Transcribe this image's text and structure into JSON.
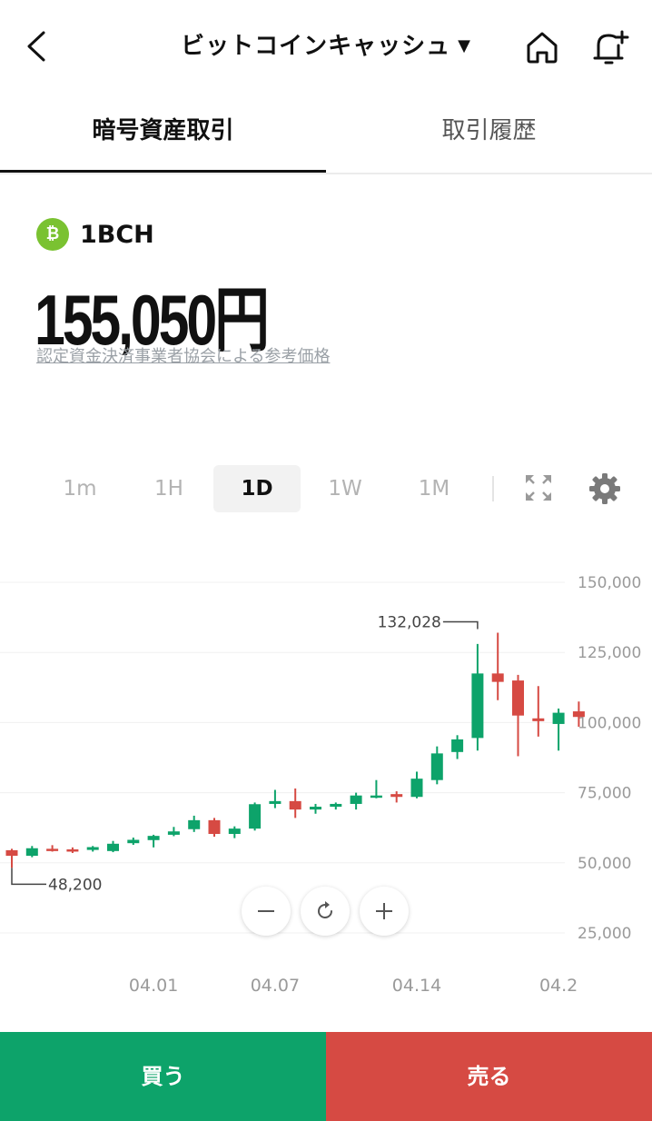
{
  "header": {
    "title": "ビットコインキャッシュ",
    "caret": "▼"
  },
  "tabs": {
    "trade": "暗号資産取引",
    "history": "取引履歴"
  },
  "asset": {
    "coin_symbol": "₿",
    "name": "1BCH",
    "price": "155,050円",
    "reference_link": "認定資金決済事業者協会による参考価格"
  },
  "periods": [
    "1m",
    "1H",
    "1D",
    "1W",
    "1M"
  ],
  "selected_period": "1D",
  "icons": {
    "back": "chevron-left-icon",
    "home": "home-icon",
    "alert": "bell-plus-icon",
    "expand": "fullscreen-icon",
    "settings": "gear-icon",
    "zoom_out": "minus-icon",
    "reset": "refresh-icon",
    "zoom_in": "plus-icon"
  },
  "colors": {
    "up": "#0da36a",
    "down": "#d64a43",
    "coin": "#7ac231"
  },
  "chart_data": {
    "type": "candlestick",
    "y_ticks": [
      "150,000",
      "125,000",
      "100,000",
      "75,000",
      "50,000",
      "25,000"
    ],
    "ylim": [
      25000,
      150000
    ],
    "x_ticks": [
      {
        "label": "04.01",
        "index": 7
      },
      {
        "label": "04.07",
        "index": 13
      },
      {
        "label": "04.14",
        "index": 20
      },
      {
        "label": "04.2",
        "index": 27
      }
    ],
    "annotations": {
      "high": {
        "label": "132,028",
        "value": 132028,
        "index": 23
      },
      "low": {
        "label": "48,200",
        "value": 48200,
        "index": 0
      }
    },
    "candles": [
      {
        "o": 54500,
        "h": 55000,
        "l": 48200,
        "c": 52500
      },
      {
        "o": 52500,
        "h": 56000,
        "l": 52000,
        "c": 55200
      },
      {
        "o": 55000,
        "h": 56300,
        "l": 54000,
        "c": 54300
      },
      {
        "o": 54800,
        "h": 55500,
        "l": 53500,
        "c": 54000
      },
      {
        "o": 54600,
        "h": 56000,
        "l": 54000,
        "c": 55600
      },
      {
        "o": 54200,
        "h": 57800,
        "l": 53800,
        "c": 56800
      },
      {
        "o": 57000,
        "h": 59000,
        "l": 56400,
        "c": 58200
      },
      {
        "o": 58100,
        "h": 60000,
        "l": 55500,
        "c": 59600
      },
      {
        "o": 60000,
        "h": 62800,
        "l": 59500,
        "c": 61200
      },
      {
        "o": 62000,
        "h": 66800,
        "l": 61000,
        "c": 65200
      },
      {
        "o": 65200,
        "h": 66000,
        "l": 59300,
        "c": 60300
      },
      {
        "o": 60300,
        "h": 63000,
        "l": 58800,
        "c": 62200
      },
      {
        "o": 62200,
        "h": 71500,
        "l": 61500,
        "c": 70900
      },
      {
        "o": 71000,
        "h": 76000,
        "l": 69500,
        "c": 72000
      },
      {
        "o": 72000,
        "h": 76500,
        "l": 66000,
        "c": 69000
      },
      {
        "o": 69000,
        "h": 71000,
        "l": 67500,
        "c": 70000
      },
      {
        "o": 70000,
        "h": 71500,
        "l": 69000,
        "c": 71000
      },
      {
        "o": 71000,
        "h": 75000,
        "l": 69000,
        "c": 74000
      },
      {
        "o": 73500,
        "h": 79500,
        "l": 73000,
        "c": 74000
      },
      {
        "o": 74500,
        "h": 75500,
        "l": 71500,
        "c": 73500
      },
      {
        "o": 73500,
        "h": 82500,
        "l": 73000,
        "c": 80000
      },
      {
        "o": 79500,
        "h": 91500,
        "l": 78000,
        "c": 89000
      },
      {
        "o": 89500,
        "h": 95500,
        "l": 87000,
        "c": 94000
      },
      {
        "o": 94500,
        "h": 128000,
        "l": 90000,
        "c": 117500
      },
      {
        "o": 117500,
        "h": 132028,
        "l": 108000,
        "c": 114500
      },
      {
        "o": 115000,
        "h": 117000,
        "l": 88000,
        "c": 102500
      },
      {
        "o": 101500,
        "h": 113000,
        "l": 95000,
        "c": 100500
      },
      {
        "o": 99500,
        "h": 105000,
        "l": 90000,
        "c": 103500
      },
      {
        "o": 104000,
        "h": 107500,
        "l": 98500,
        "c": 102000
      }
    ]
  },
  "actions": {
    "buy": "買う",
    "sell": "売る"
  }
}
